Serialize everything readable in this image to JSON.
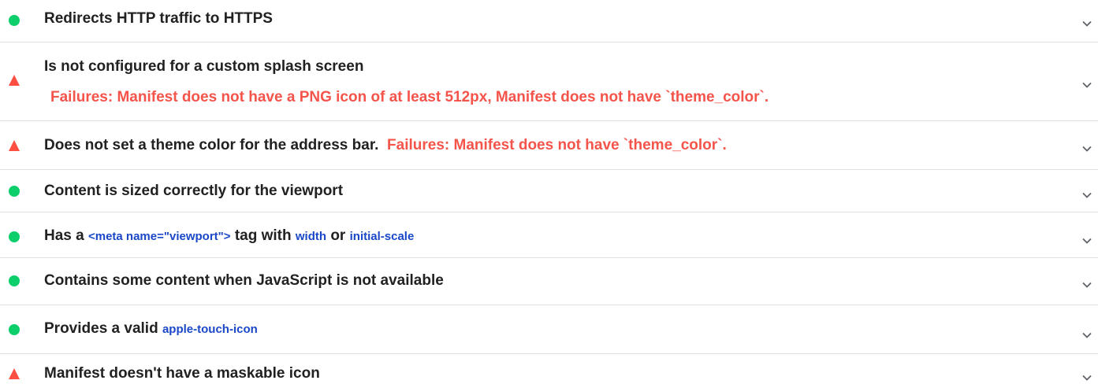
{
  "colors": {
    "pass": "#0cce6b",
    "fail": "#ff4e42",
    "failure_text": "#f4544a",
    "code_text": "#1a47c7",
    "divider": "#e0e0e0"
  },
  "audits": [
    {
      "status": "pass",
      "title": "Redirects HTTP traffic to HTTPS"
    },
    {
      "status": "fail",
      "title": "Is not configured for a custom splash screen",
      "failure": "Failures: Manifest does not have a PNG icon of at least 512px, Manifest does not have `theme_color`."
    },
    {
      "status": "fail",
      "title": "Does not set a theme color for the address bar.",
      "failure": "Failures: Manifest does not have `theme_color`."
    },
    {
      "status": "pass",
      "title": "Content is sized correctly for the viewport"
    },
    {
      "status": "pass",
      "title_prefix": "Has a",
      "code1": "<meta name=\"viewport\">",
      "title_mid1": "tag with",
      "code2": "width",
      "title_mid2": "or",
      "code3": "initial-scale"
    },
    {
      "status": "pass",
      "title": "Contains some content when JavaScript is not available"
    },
    {
      "status": "pass",
      "title_prefix": "Provides a valid",
      "code1": "apple-touch-icon"
    },
    {
      "status": "fail",
      "title": "Manifest doesn't have a maskable icon"
    }
  ]
}
